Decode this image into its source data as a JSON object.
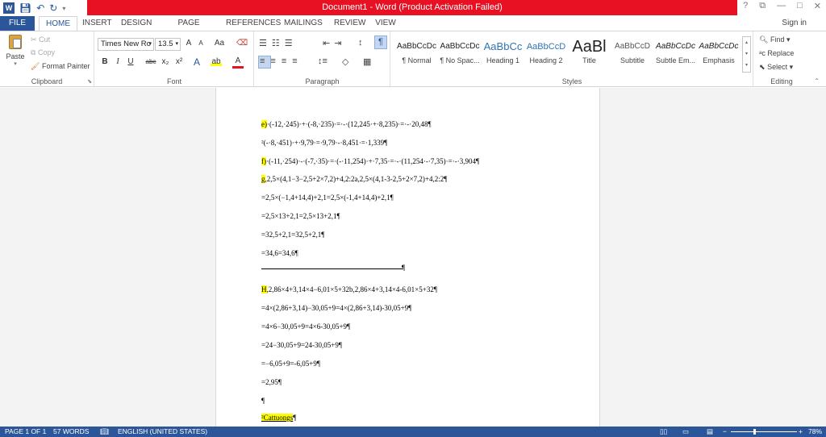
{
  "title_bar": {
    "text": "Document1 - Word (Product Activation Failed)",
    "controls": [
      "?",
      "⧉",
      "—",
      "□",
      "✕"
    ]
  },
  "quick_access": {
    "word_icon": "word-logo-icon",
    "save_icon": "save-icon",
    "undo_icon": "undo-icon",
    "redo_icon": "redo-icon"
  },
  "tabs": [
    "FILE",
    "HOME",
    "INSERT",
    "DESIGN",
    "PAGE LAYOUT",
    "REFERENCES",
    "MAILINGS",
    "REVIEW",
    "VIEW"
  ],
  "sign_in": "Sign in",
  "clipboard": {
    "paste": "Paste",
    "cut": "Cut",
    "copy": "Copy",
    "format_painter": "Format Painter",
    "label": "Clipboard"
  },
  "font": {
    "name": "Times New Ro",
    "size": "13.5",
    "label": "Font",
    "grow": "A",
    "shrink": "A",
    "aa": "Aa",
    "bold": "B",
    "italic": "I",
    "underline": "U",
    "strike": "abc",
    "sub": "x₂",
    "sup": "x²"
  },
  "paragraph": {
    "label": "Paragraph",
    "pilcrow": "¶"
  },
  "styles": {
    "label": "Styles",
    "items": [
      {
        "preview": "AaBbCcDc",
        "name": "¶ Normal"
      },
      {
        "preview": "AaBbCcDc",
        "name": "¶ No Spac..."
      },
      {
        "preview": "AaBbCc",
        "name": "Heading 1"
      },
      {
        "preview": "AaBbCcD",
        "name": "Heading 2"
      },
      {
        "preview": "AaBl",
        "name": "Title"
      },
      {
        "preview": "AaBbCcD",
        "name": "Subtitle"
      },
      {
        "preview": "AaBbCcDc",
        "name": "Subtle Em..."
      },
      {
        "preview": "AaBbCcDc",
        "name": "Emphasis"
      }
    ]
  },
  "editing": {
    "find": "Find",
    "replace": "Replace",
    "select": "Select",
    "label": "Editing"
  },
  "document": {
    "lines": [
      {
        "pre": "",
        "hl": "e)",
        "text": "·(-12,·245)·+·(-8,·235)·=·-·(12,245·+·8,235)·=·-·20,48¶"
      },
      {
        "pre": "",
        "hl": "",
        "text": "²(-·8,·451)·+·9,79·=·9,79·-·8,451·=·1,339¶"
      },
      {
        "pre": "",
        "hl": "f)",
        "text": "·(-11,·254)·-·(-7,·35)·=·(-·11,254)·+·7,35·=·-·(11,254·-·7,35)·=·-·3,904¶"
      },
      {
        "pre": "",
        "hl": "g",
        "text": ",2,5×(4,1−3−2,5+2×7,2)+4,2:2a,2,5×(4,1-3-2,5+2×7,2)+4,2:2¶"
      },
      {
        "pre": "",
        "hl": "",
        "text": "=2,5×(−1,4+14,4)+2,1=2,5×(-1,4+14,4)+2,1¶"
      },
      {
        "pre": "",
        "hl": "",
        "text": "=2,5×13+2,1=2,5×13+2,1¶"
      },
      {
        "pre": "",
        "hl": "",
        "text": "=32,5+2,1=32,5+2,1¶"
      },
      {
        "pre": "",
        "hl": "",
        "text": "=34,6=34,6¶"
      },
      {
        "pre": "",
        "hl": "H",
        "text": ",2,86×4+3,14×4−6,01×5+32b,2,86×4+3,14×4-6,01×5+32¶"
      },
      {
        "pre": "",
        "hl": "",
        "text": "=4×(2,86+3,14)−30,05+9=4×(2,86+3,14)-30,05+9¶"
      },
      {
        "pre": "",
        "hl": "",
        "text": "=4×6−30,05+9=4×6-30,05+9¶"
      },
      {
        "pre": "",
        "hl": "",
        "text": "=24−30,05+9=24-30,05+9¶"
      },
      {
        "pre": "",
        "hl": "",
        "text": "=−6,05+9=-6,05+9¶"
      },
      {
        "pre": "",
        "hl": "",
        "text": "=2,95¶"
      },
      {
        "pre": "",
        "hl": "",
        "text": "¶"
      },
      {
        "pre": "",
        "hl": "²Cattuongs",
        "text": "¶"
      }
    ],
    "hr_pilcrow": "¶"
  },
  "status": {
    "page": "PAGE 1 OF 1",
    "words": "57 WORDS",
    "lang": "ENGLISH (UNITED STATES)",
    "zoom": "78%"
  }
}
